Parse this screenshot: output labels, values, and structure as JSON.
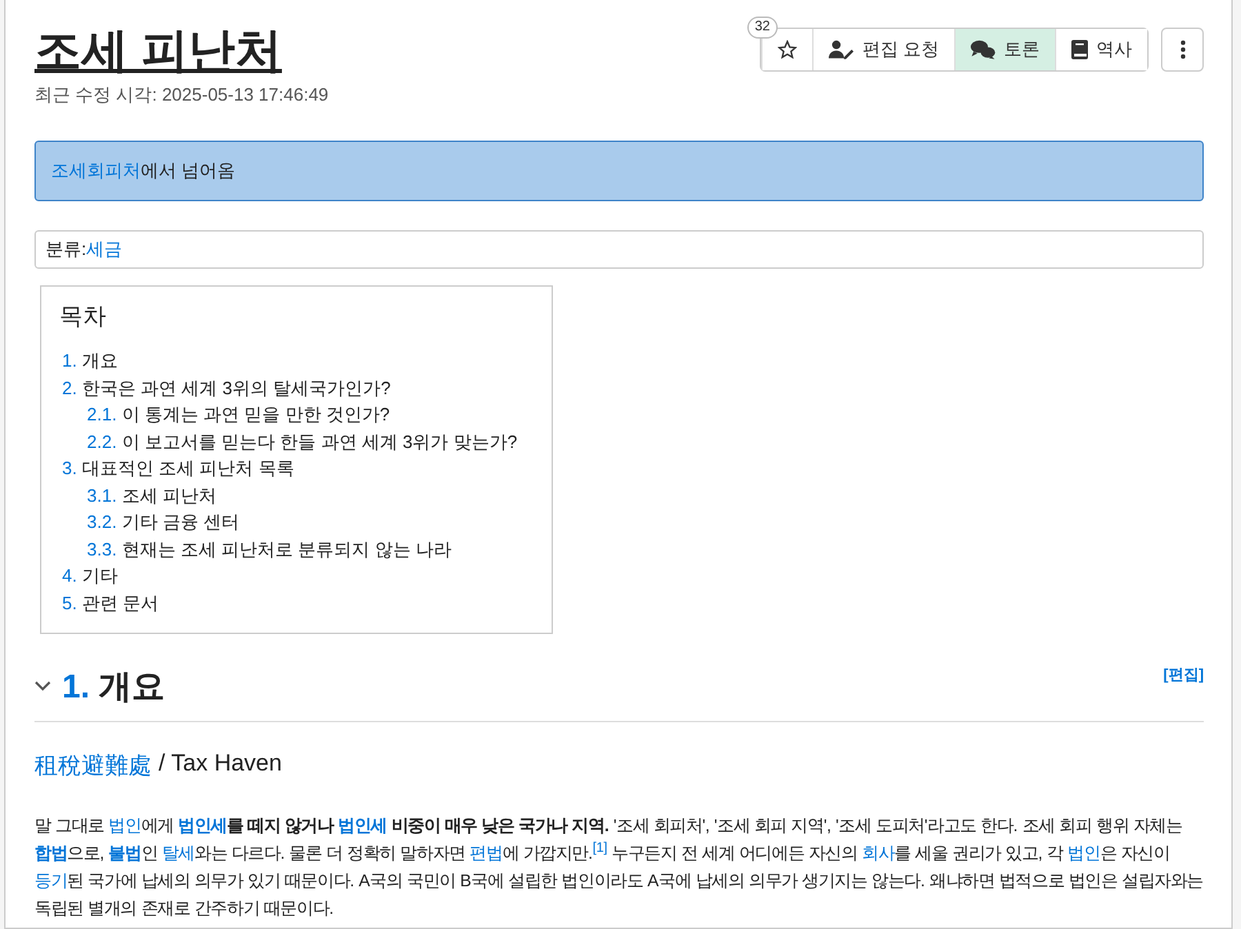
{
  "article": {
    "title": "조세 피난처",
    "modified": "최근 수정 시각: 2025-05-13 17:46:49"
  },
  "toolbar": {
    "star_count": "32",
    "buttons": [
      {
        "kind": "star",
        "highlighted": false
      },
      {
        "kind": "edit-request",
        "label": "편집 요청",
        "highlighted": false
      },
      {
        "kind": "discussion",
        "label": "토론",
        "highlighted": true
      },
      {
        "kind": "history",
        "label": "역사",
        "highlighted": false
      }
    ]
  },
  "redirect": {
    "link": "조세회피처",
    "text": "에서 넘어옴"
  },
  "category": {
    "label": "분류:",
    "link": "세금"
  },
  "toc": {
    "title": "목차",
    "items": [
      {
        "number": "1.",
        "label": "개요"
      },
      {
        "number": "2.",
        "label": "한국은 과연 세계 3위의 탈세국가인가?",
        "children": [
          {
            "number": "2.1.",
            "label": "이 통계는 과연 믿을 만한 것인가?"
          },
          {
            "number": "2.2.",
            "label": "이 보고서를 믿는다 한들 과연 세계 3위가 맞는가?"
          }
        ]
      },
      {
        "number": "3.",
        "label": "대표적인 조세 피난처 목록",
        "children": [
          {
            "number": "3.1.",
            "label": "조세 피난처"
          },
          {
            "number": "3.2.",
            "label": "기타 금융 센터"
          },
          {
            "number": "3.3.",
            "label": "현재는 조세 피난처로 분류되지 않는 나라"
          }
        ]
      },
      {
        "number": "4.",
        "label": "기타"
      },
      {
        "number": "5.",
        "label": "관련 문서"
      }
    ]
  },
  "section": {
    "number": "1.",
    "title": "개요",
    "expanded": true,
    "edit": "[편집]",
    "subtitle": {
      "link": "租稅避難處",
      "text": "/ Tax Haven"
    },
    "paragraph": [
      {
        "kind": "text",
        "text": "말 그대로 "
      },
      {
        "kind": "link",
        "text": "법인",
        "bold": false
      },
      {
        "kind": "text",
        "text": "에게 "
      },
      {
        "kind": "link",
        "text": "법인세",
        "bold": true
      },
      {
        "kind": "text",
        "text": "**를 떼지 않거나** "
      },
      {
        "kind": "link",
        "text": "법인세",
        "bold": true
      },
      {
        "kind": "text",
        "text": " **비중이 매우 낮은 국가나 지역.** '조세 회피처', '조세 회피 지역', '조세 도피처'라고도 한다. 조세 회피 행위 자체는 "
      },
      {
        "kind": "link",
        "text": "합법",
        "bold": true
      },
      {
        "kind": "text",
        "text": "으로, "
      },
      {
        "kind": "link",
        "text": "불법",
        "bold": true
      },
      {
        "kind": "text",
        "text": "인 "
      },
      {
        "kind": "link",
        "text": "탈세",
        "bold": false
      },
      {
        "kind": "text",
        "text": "와는 다르다. 물론 더 정확히 말하자면 "
      },
      {
        "kind": "link",
        "text": "편법",
        "bold": false
      },
      {
        "kind": "text",
        "text": "에 가깝지만."
      },
      {
        "kind": "footnote",
        "text": "[1]"
      },
      {
        "kind": "text",
        "text": " 누구든지 전 세계 어디에든 자신의 "
      },
      {
        "kind": "link",
        "text": "회사",
        "bold": false
      },
      {
        "kind": "text",
        "text": "를 세울 권리가 있고, 각 "
      },
      {
        "kind": "link",
        "text": "법인",
        "bold": false
      },
      {
        "kind": "text",
        "text": "은 자신이 "
      },
      {
        "kind": "link",
        "text": "등기",
        "bold": false
      },
      {
        "kind": "text",
        "text": "된 국가에 납세의 의무가 있기 때문이다. A국의 국민이 B국에 설립한 법인이라도 A국에 납세의 의무가 생기지는 않는다. 왜냐하면 법적으로 법인은 설립자와는 독립된 별개의 존재로 간주하기 때문이다."
      }
    ]
  }
}
